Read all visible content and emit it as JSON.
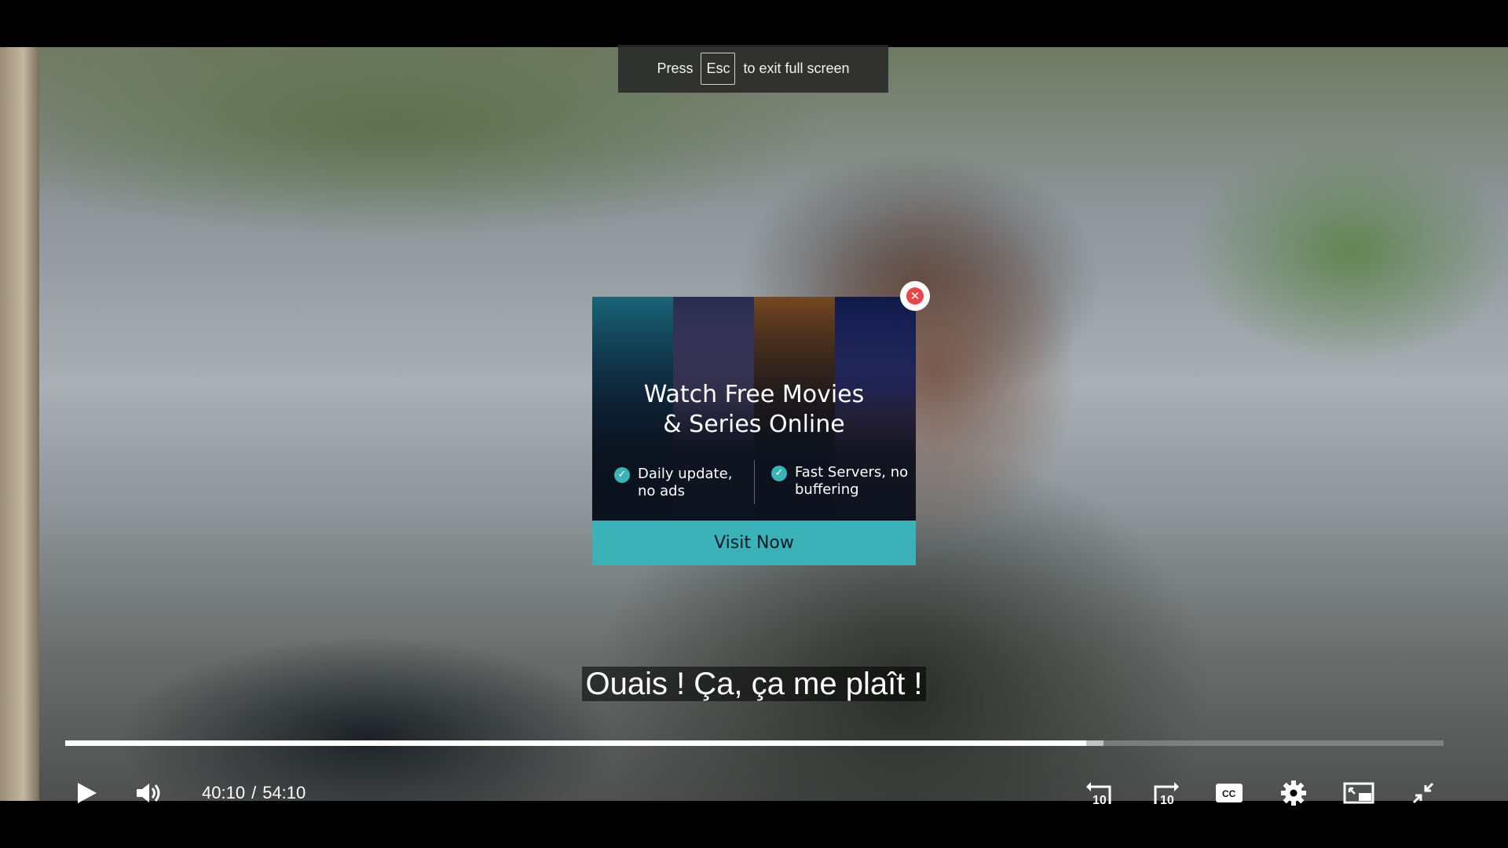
{
  "fullscreen_hint": {
    "press": "Press",
    "key": "Esc",
    "rest": "to exit full screen"
  },
  "ad": {
    "title_line1": "Watch Free Movies",
    "title_line2": "& Series Online",
    "feature1": "Daily update, no ads",
    "feature2": "Fast Servers, no buffering",
    "cta": "Visit Now",
    "accent_color": "#3bb2b8",
    "close_color": "#e8474a"
  },
  "subtitle": "Ouais ! Ça, ça me plaît !",
  "player": {
    "current_time": "40:10",
    "separator": "/",
    "duration": "54:10",
    "progress_fraction": 0.741,
    "buffered_fraction": 0.753,
    "icons": [
      "play-icon",
      "volume-icon",
      "rewind-10-icon",
      "forward-10-icon",
      "captions-icon",
      "settings-icon",
      "miniplayer-icon",
      "exit-fullscreen-icon"
    ]
  }
}
